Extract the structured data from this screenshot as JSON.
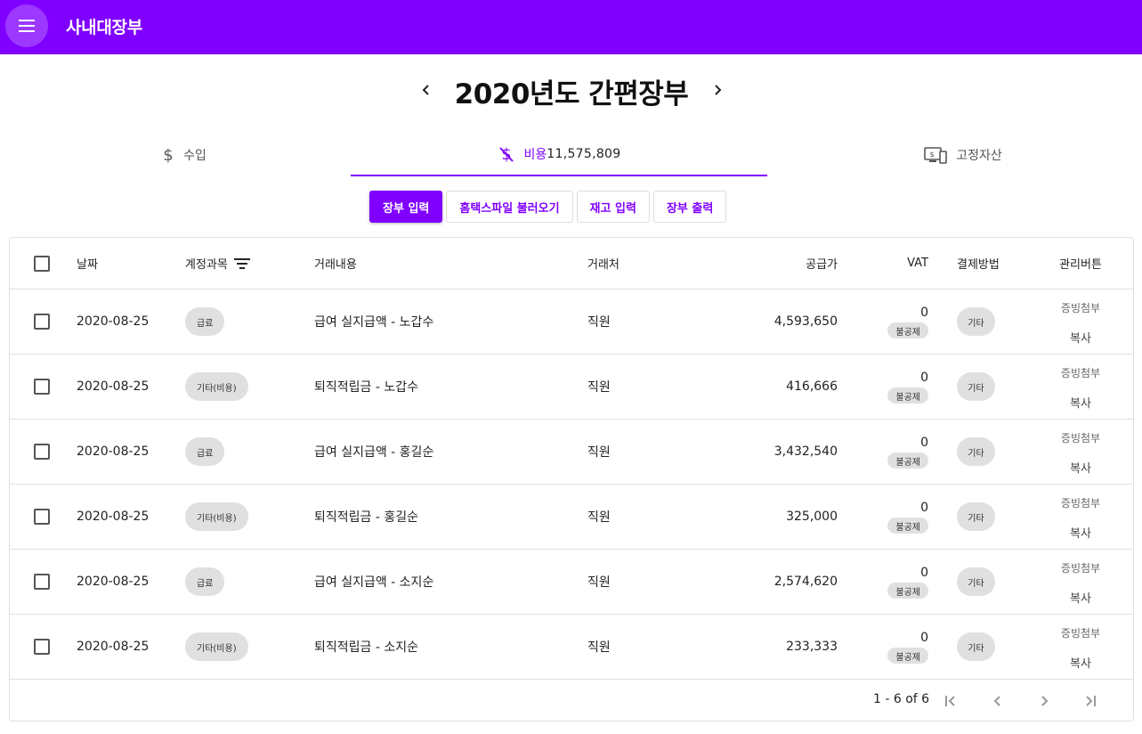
{
  "app": {
    "title": "사내대장부"
  },
  "header": {
    "year_title": "2020년도 간편장부"
  },
  "tabs": {
    "income": {
      "label": "수입"
    },
    "expense": {
      "label": "비용",
      "total": "11,575,809"
    },
    "assets": {
      "label": "고정자산"
    }
  },
  "actions": [
    "장부 입력",
    "홈택스파일 불러오기",
    "재고 입력",
    "장부 출력"
  ],
  "table": {
    "columns": {
      "date": "날짜",
      "account": "계정과목",
      "description": "거래내용",
      "vendor": "거래처",
      "supply": "공급가",
      "vat": "VAT",
      "payment": "결제방법",
      "management": "관리버튼"
    },
    "rows": [
      {
        "date": "2020-08-25",
        "account": "급료",
        "description": "급여 실지급액 - 노갑수",
        "vendor": "직원",
        "supply": "4,593,650",
        "vat": "0",
        "vat_tag": "불공제",
        "payment": "기타",
        "attach": "증빙첨부",
        "copy": "복사"
      },
      {
        "date": "2020-08-25",
        "account": "기타(비용)",
        "description": "퇴직적립금 - 노갑수",
        "vendor": "직원",
        "supply": "416,666",
        "vat": "0",
        "vat_tag": "불공제",
        "payment": "기타",
        "attach": "증빙첨부",
        "copy": "복사"
      },
      {
        "date": "2020-08-25",
        "account": "급료",
        "description": "급여 실지급액 - 홍길순",
        "vendor": "직원",
        "supply": "3,432,540",
        "vat": "0",
        "vat_tag": "불공제",
        "payment": "기타",
        "attach": "증빙첨부",
        "copy": "복사"
      },
      {
        "date": "2020-08-25",
        "account": "기타(비용)",
        "description": "퇴직적립금 - 홍길순",
        "vendor": "직원",
        "supply": "325,000",
        "vat": "0",
        "vat_tag": "불공제",
        "payment": "기타",
        "attach": "증빙첨부",
        "copy": "복사"
      },
      {
        "date": "2020-08-25",
        "account": "급료",
        "description": "급여 실지급액 - 소지순",
        "vendor": "직원",
        "supply": "2,574,620",
        "vat": "0",
        "vat_tag": "불공제",
        "payment": "기타",
        "attach": "증빙첨부",
        "copy": "복사"
      },
      {
        "date": "2020-08-25",
        "account": "기타(비용)",
        "description": "퇴직적립금 - 소지순",
        "vendor": "직원",
        "supply": "233,333",
        "vat": "0",
        "vat_tag": "불공제",
        "payment": "기타",
        "attach": "증빙첨부",
        "copy": "복사"
      }
    ]
  },
  "pagination": {
    "info": "1 - 6 of 6"
  },
  "icons": {
    "menu": "menu-icon",
    "prev": "chevron-left-icon",
    "next": "chevron-right-icon",
    "income": "dollar-icon",
    "expense": "money-off-icon",
    "assets": "devices-icon",
    "filter": "filter-list-icon",
    "first_page": "first-page-icon",
    "last_page": "last-page-icon"
  },
  "colors": {
    "accent": "#8000ff",
    "chip": "#e0e0e0"
  }
}
